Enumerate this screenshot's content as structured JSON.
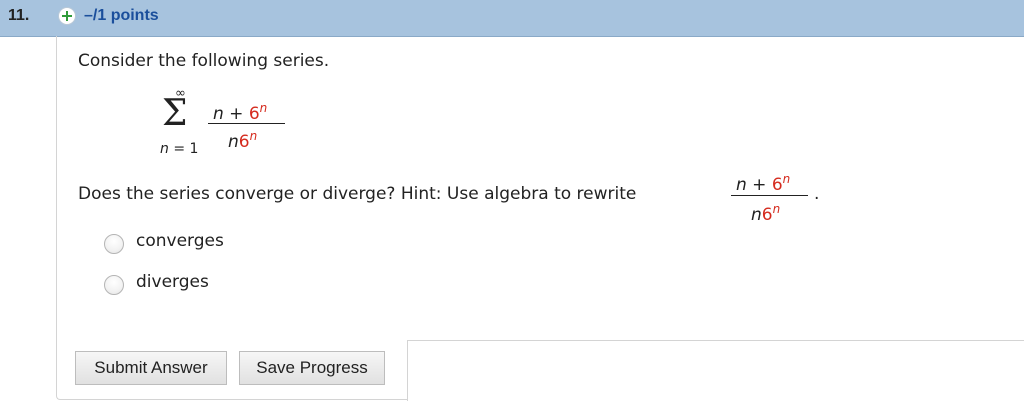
{
  "header": {
    "question_number": "11.",
    "points": "–/1 points"
  },
  "problem": {
    "intro": "Consider the following series.",
    "series": {
      "upper_limit": "∞",
      "lower_var": "n",
      "lower_eq": " = 1",
      "numerator_n": "n",
      "numerator_plus": " + ",
      "numerator_base": "6",
      "numerator_exp": "n",
      "denominator_n": "n",
      "denominator_base": "6",
      "denominator_exp": "n"
    },
    "question": "Does the series converge or diverge? Hint: Use algebra to rewrite",
    "hint_fraction": {
      "numerator_n": "n",
      "numerator_plus": " + ",
      "numerator_base": "6",
      "numerator_exp": "n",
      "denominator_n": "n",
      "denominator_base": "6",
      "denominator_exp": "n"
    },
    "period": "."
  },
  "options": [
    {
      "label": "converges",
      "selected": false
    },
    {
      "label": "diverges",
      "selected": false
    }
  ],
  "buttons": {
    "submit": "Submit Answer",
    "save": "Save Progress"
  },
  "colors": {
    "header_bg": "#a7c3de",
    "points_text": "#1b4f9c",
    "highlight": "#d52b1e",
    "plus_icon": "#2f9b3a"
  }
}
